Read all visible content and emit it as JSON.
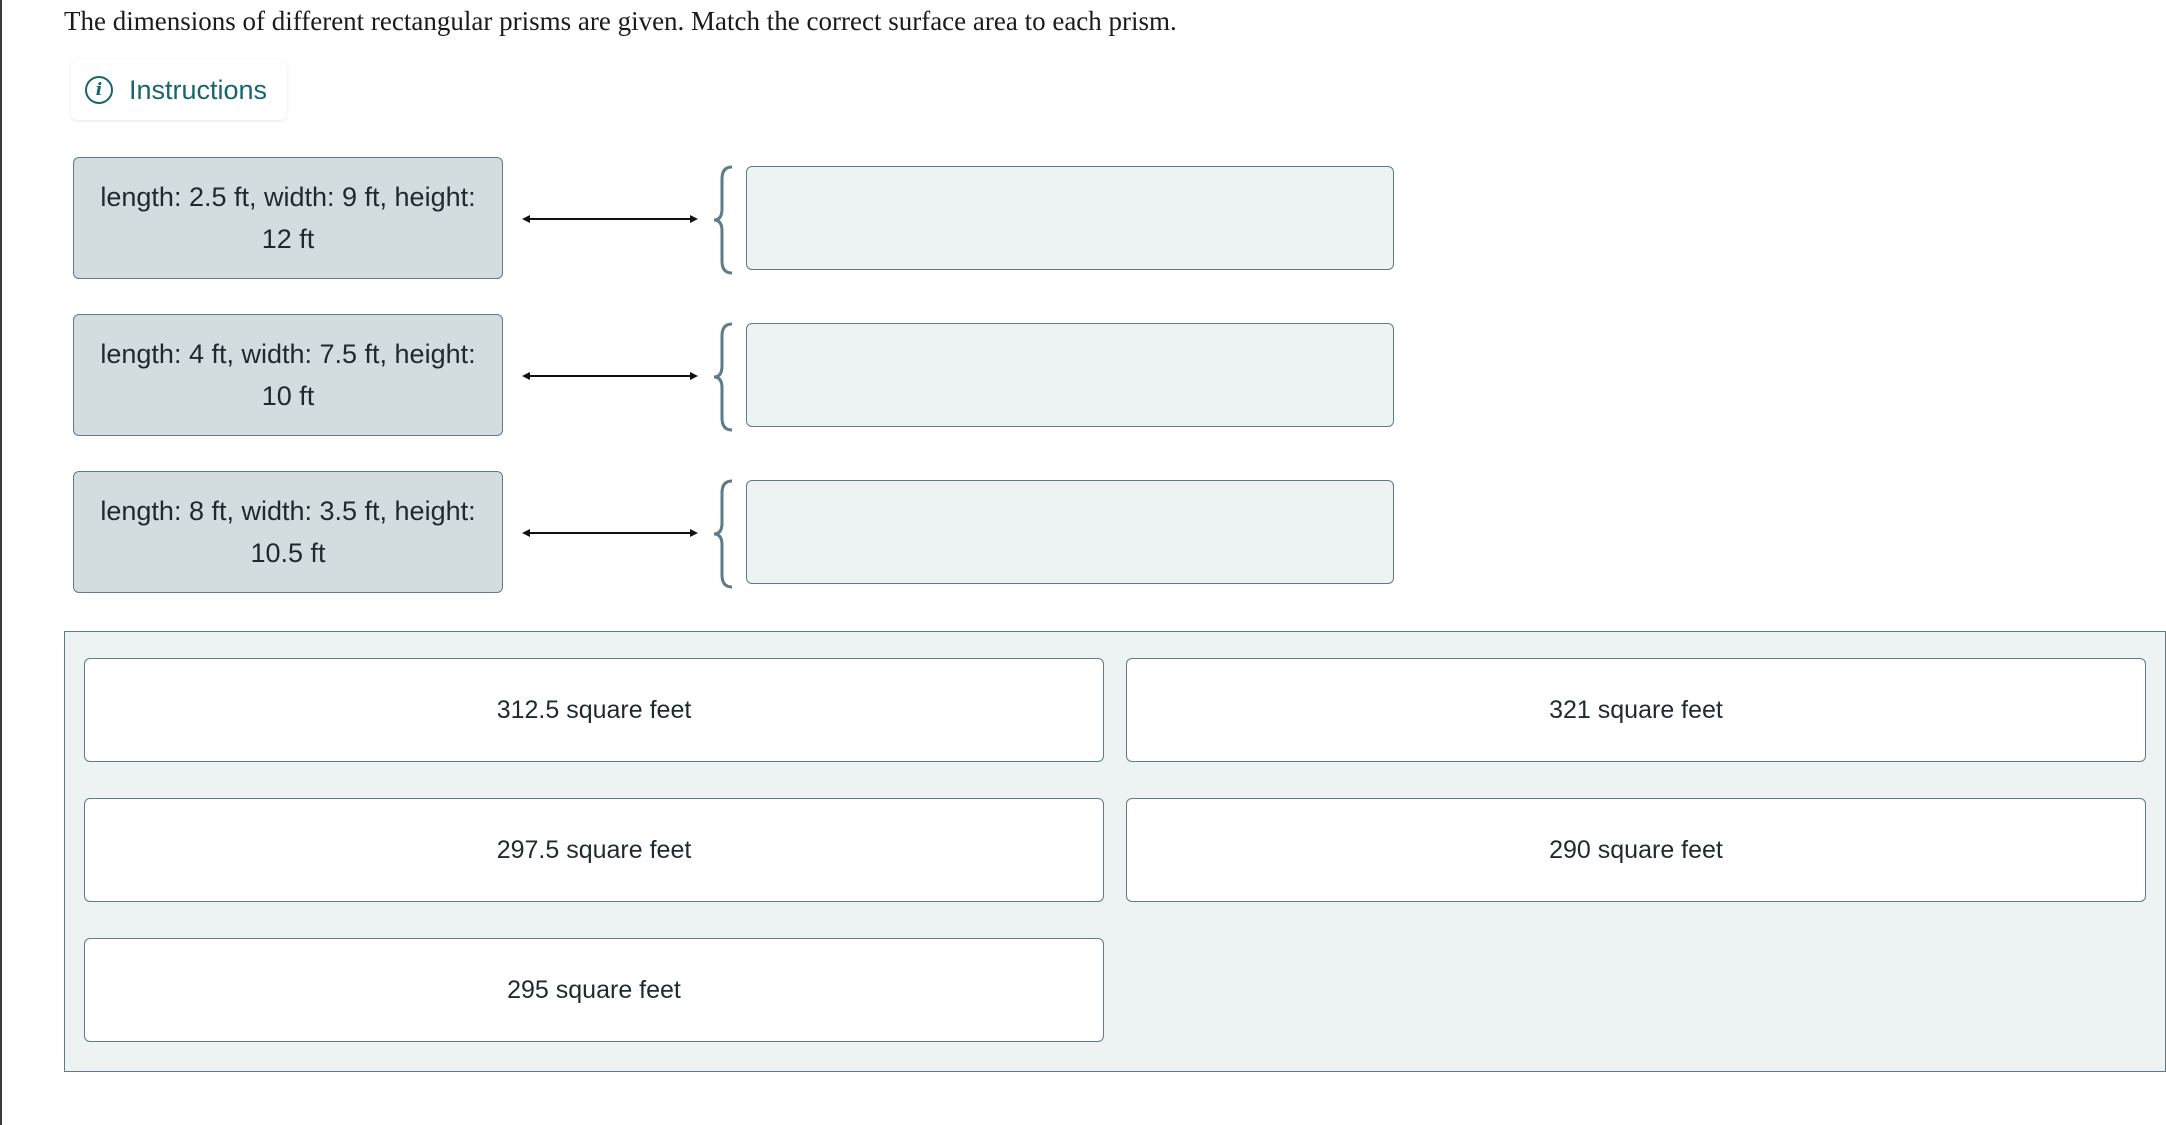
{
  "question": {
    "text": "The dimensions of different rectangular prisms are given. Match the correct surface area to each prism."
  },
  "instructions": {
    "label": "Instructions",
    "icon": "info-icon"
  },
  "prompts": [
    {
      "line1": "length: 2.5 ft, width: 9 ft, height:",
      "line2": "12 ft"
    },
    {
      "line1": "length: 4 ft, width: 7.5 ft, height:",
      "line2": "10 ft"
    },
    {
      "line1": "length: 8 ft, width: 3.5 ft, height:",
      "line2": "10.5 ft"
    }
  ],
  "answers": [
    {
      "label": "312.5 square feet"
    },
    {
      "label": "321 square feet"
    },
    {
      "label": "297.5 square feet"
    },
    {
      "label": "290 square feet"
    },
    {
      "label": "295 square feet"
    }
  ],
  "colors": {
    "accent": "#16666b",
    "prompt_card_bg": "#d3dde0",
    "drop_zone_bg": "#edf2f2",
    "border": "#5f7b86"
  }
}
